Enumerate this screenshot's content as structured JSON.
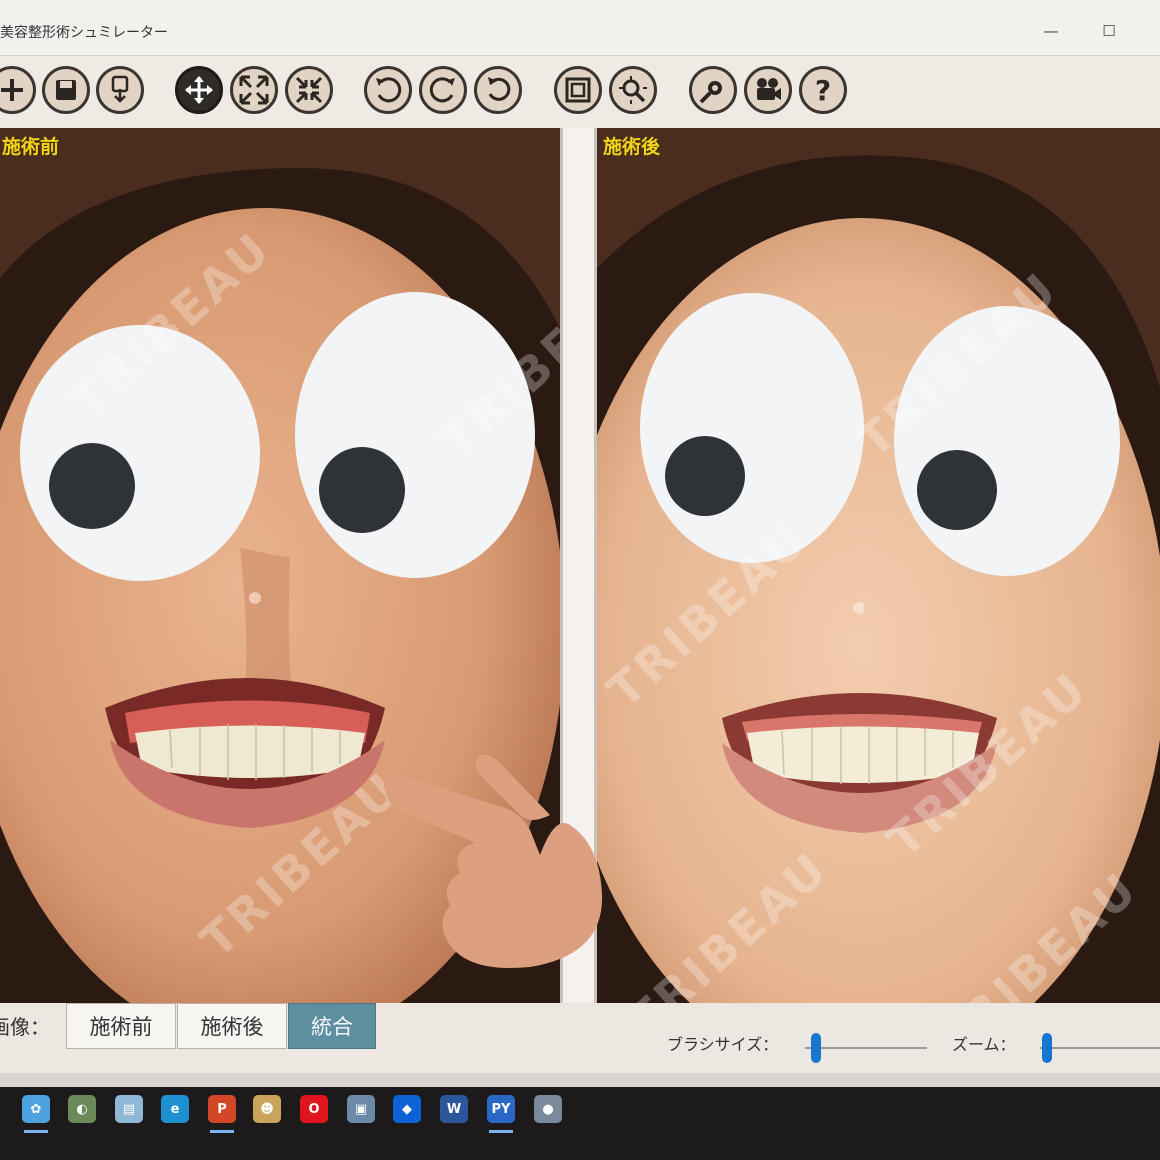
{
  "window": {
    "title": "美容整形術シュミレーター",
    "minimize_label": "—",
    "maximize_label": "☐"
  },
  "toolbar": {
    "buttons": [
      {
        "name": "add-icon"
      },
      {
        "name": "save-icon"
      },
      {
        "name": "save-as-icon"
      },
      {
        "name": "move-icon"
      },
      {
        "name": "expand-icon"
      },
      {
        "name": "shrink-icon"
      },
      {
        "name": "rotate-left-icon"
      },
      {
        "name": "rotate-right-icon"
      },
      {
        "name": "reset-rotation-icon"
      },
      {
        "name": "fit-window-icon"
      },
      {
        "name": "zoom-search-icon"
      },
      {
        "name": "settings-icon"
      },
      {
        "name": "video-camera-icon"
      },
      {
        "name": "help-icon"
      }
    ],
    "help_label": "?"
  },
  "panels": {
    "before_label": "施術前",
    "after_label": "施術後"
  },
  "watermark": "TRIBEAU",
  "bottom": {
    "image_label": "画像：",
    "modes": [
      "施術前",
      "施術後",
      "統合"
    ],
    "active_mode": "統合",
    "brush_size_label": "ブラシサイズ：",
    "brush_size_level": 0.09,
    "zoom_label": "ズーム：",
    "zoom_level": 0.06
  },
  "taskbar": {
    "icons": [
      {
        "name": "butterfly-app-icon",
        "color": "#4da3e0",
        "glyph": "✿"
      },
      {
        "name": "paint-app-icon",
        "color": "#6a8a5a",
        "glyph": "◐"
      },
      {
        "name": "notepad-app-icon",
        "color": "#8fb7d6",
        "glyph": "▤"
      },
      {
        "name": "edge-browser-icon",
        "color": "#1e8fd0",
        "glyph": "e"
      },
      {
        "name": "powerpoint-icon",
        "color": "#d24726",
        "glyph": "P"
      },
      {
        "name": "people-app-icon",
        "color": "#c9a45a",
        "glyph": "☻"
      },
      {
        "name": "opera-browser-icon",
        "color": "#e0141e",
        "glyph": "O"
      },
      {
        "name": "remote-desktop-icon",
        "color": "#6c8aa8",
        "glyph": "▣"
      },
      {
        "name": "dropbox-icon",
        "color": "#0d63d6",
        "glyph": "◆"
      },
      {
        "name": "word-icon",
        "color": "#2b579a",
        "glyph": "W"
      },
      {
        "name": "python-app-icon",
        "color": "#2a68c8",
        "glyph": "PY"
      },
      {
        "name": "media-player-icon",
        "color": "#7a8a9a",
        "glyph": "●"
      }
    ]
  }
}
